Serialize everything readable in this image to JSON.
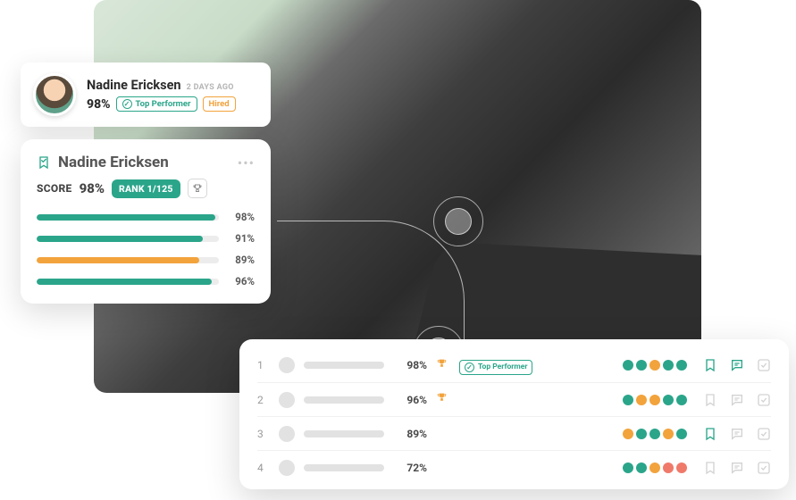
{
  "colors": {
    "teal": "#2aa58a",
    "orange": "#f2a33c",
    "coral": "#f07a6a"
  },
  "candidate_card": {
    "name": "Nadine Ericksen",
    "time_ago": "2 DAYS AGO",
    "score": "98%",
    "top_performer_label": "Top Performer",
    "hired_label": "Hired"
  },
  "detail_card": {
    "name": "Nadine Ericksen",
    "score_label": "SCORE",
    "score_value": "98%",
    "rank_label": "RANK 1/125",
    "bars": [
      {
        "pct": 98,
        "pct_label": "98%",
        "color": "teal"
      },
      {
        "pct": 91,
        "pct_label": "91%",
        "color": "teal"
      },
      {
        "pct": 89,
        "pct_label": "89%",
        "color": "orange"
      },
      {
        "pct": 96,
        "pct_label": "96%",
        "color": "teal"
      }
    ]
  },
  "leaderboard": {
    "top_performer_label": "Top Performer",
    "rows": [
      {
        "rank": "1",
        "score": "98%",
        "trophy": true,
        "top_performer": true,
        "dots": [
          "t",
          "t",
          "o",
          "t",
          "t"
        ],
        "bookmark_on": true,
        "chat_on": true
      },
      {
        "rank": "2",
        "score": "96%",
        "trophy": true,
        "top_performer": false,
        "dots": [
          "t",
          "o",
          "o",
          "t",
          "t"
        ],
        "bookmark_on": false,
        "chat_on": false
      },
      {
        "rank": "3",
        "score": "89%",
        "trophy": false,
        "top_performer": false,
        "dots": [
          "o",
          "t",
          "t",
          "o",
          "t"
        ],
        "bookmark_on": true,
        "chat_on": false
      },
      {
        "rank": "4",
        "score": "72%",
        "trophy": false,
        "top_performer": false,
        "dots": [
          "t",
          "t",
          "o",
          "r",
          "r"
        ],
        "bookmark_on": false,
        "chat_on": false
      }
    ]
  }
}
